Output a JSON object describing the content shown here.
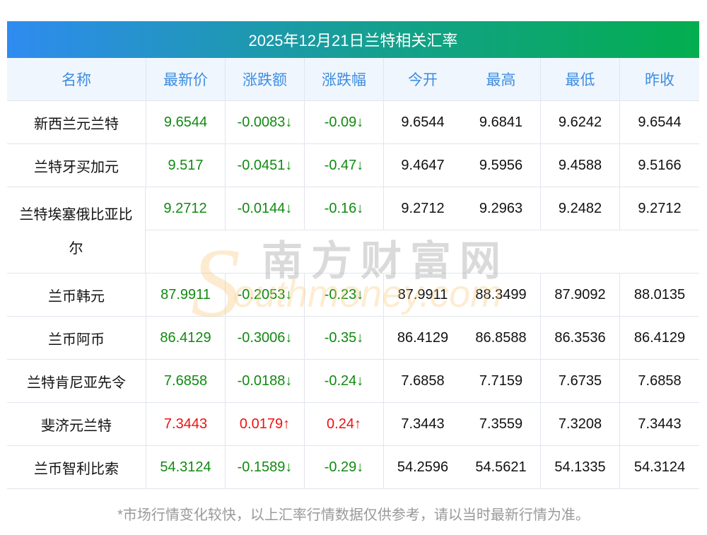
{
  "title": "2025年12月21日兰特相关汇率",
  "columns": [
    "名称",
    "最新价",
    "涨跌额",
    "涨跌幅",
    "今开",
    "最高",
    "最低",
    "昨收"
  ],
  "rows": [
    {
      "name": "新西兰元兰特",
      "latest": "9.6544",
      "change": "-0.0083↓",
      "pct": "-0.09↓",
      "open": "9.6544",
      "high": "9.6841",
      "low": "9.6242",
      "prev": "9.6544",
      "dir": "down"
    },
    {
      "name": "兰特牙买加元",
      "latest": "9.517",
      "change": "-0.0451↓",
      "pct": "-0.47↓",
      "open": "9.4647",
      "high": "9.5956",
      "low": "9.4588",
      "prev": "9.5166",
      "dir": "down"
    },
    {
      "name_line1": "兰特埃塞俄比亚比",
      "name_line2": "尔",
      "latest": "9.2712",
      "change": "-0.0144↓",
      "pct": "-0.16↓",
      "open": "9.2712",
      "high": "9.2963",
      "low": "9.2482",
      "prev": "9.2712",
      "dir": "down"
    },
    {
      "name": "兰币韩元",
      "latest": "87.9911",
      "change": "-0.2053↓",
      "pct": "-0.23↓",
      "open": "87.9911",
      "high": "88.3499",
      "low": "87.9092",
      "prev": "88.0135",
      "dir": "down"
    },
    {
      "name": "兰币阿币",
      "latest": "86.4129",
      "change": "-0.3006↓",
      "pct": "-0.35↓",
      "open": "86.4129",
      "high": "86.8588",
      "low": "86.3536",
      "prev": "86.4129",
      "dir": "down"
    },
    {
      "name": "兰特肯尼亚先令",
      "latest": "7.6858",
      "change": "-0.0188↓",
      "pct": "-0.24↓",
      "open": "7.6858",
      "high": "7.7159",
      "low": "7.6735",
      "prev": "7.6858",
      "dir": "down"
    },
    {
      "name": "斐济元兰特",
      "latest": "7.3443",
      "change": "0.0179↑",
      "pct": "0.24↑",
      "open": "7.3443",
      "high": "7.3559",
      "low": "7.3208",
      "prev": "7.3443",
      "dir": "up"
    },
    {
      "name": "兰币智利比索",
      "latest": "54.3124",
      "change": "-0.1589↓",
      "pct": "-0.29↓",
      "open": "54.2596",
      "high": "54.5621",
      "low": "54.1335",
      "prev": "54.3124",
      "dir": "down"
    }
  ],
  "watermark": {
    "cn": "南方财富网",
    "en_s": "S",
    "en": "outhmoney.com"
  },
  "footer": "*市场行情变化较快，以上汇率行情数据仅供参考，请以当时最新行情为准。",
  "colors": {
    "up": "#f01010",
    "down": "#118a11",
    "header_text": "#3d8de0"
  }
}
